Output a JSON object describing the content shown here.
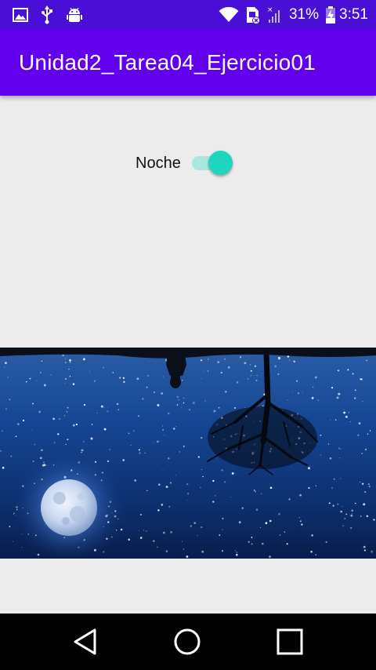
{
  "status_bar": {
    "battery_percent": "31%",
    "time": "3:51",
    "icons": [
      "image-icon",
      "usb-icon",
      "android-debug-icon",
      "wifi-icon",
      "sim-card-icon",
      "no-signal-icon",
      "battery-charging-icon"
    ]
  },
  "app_bar": {
    "title": "Unidad2_Tarea04_Ejercicio01"
  },
  "main": {
    "switch_label": "Noche",
    "switch_state": "on"
  },
  "navigation_bar": {
    "icons": [
      "back-icon",
      "home-icon",
      "recents-icon"
    ]
  },
  "colors": {
    "status_bar": "#4a0fd6",
    "app_bar": "#6200ee",
    "switch_thumb": "#1ed6bf",
    "switch_track": "#a6e8df",
    "background": "#ececec",
    "nav_bar": "#000000"
  }
}
